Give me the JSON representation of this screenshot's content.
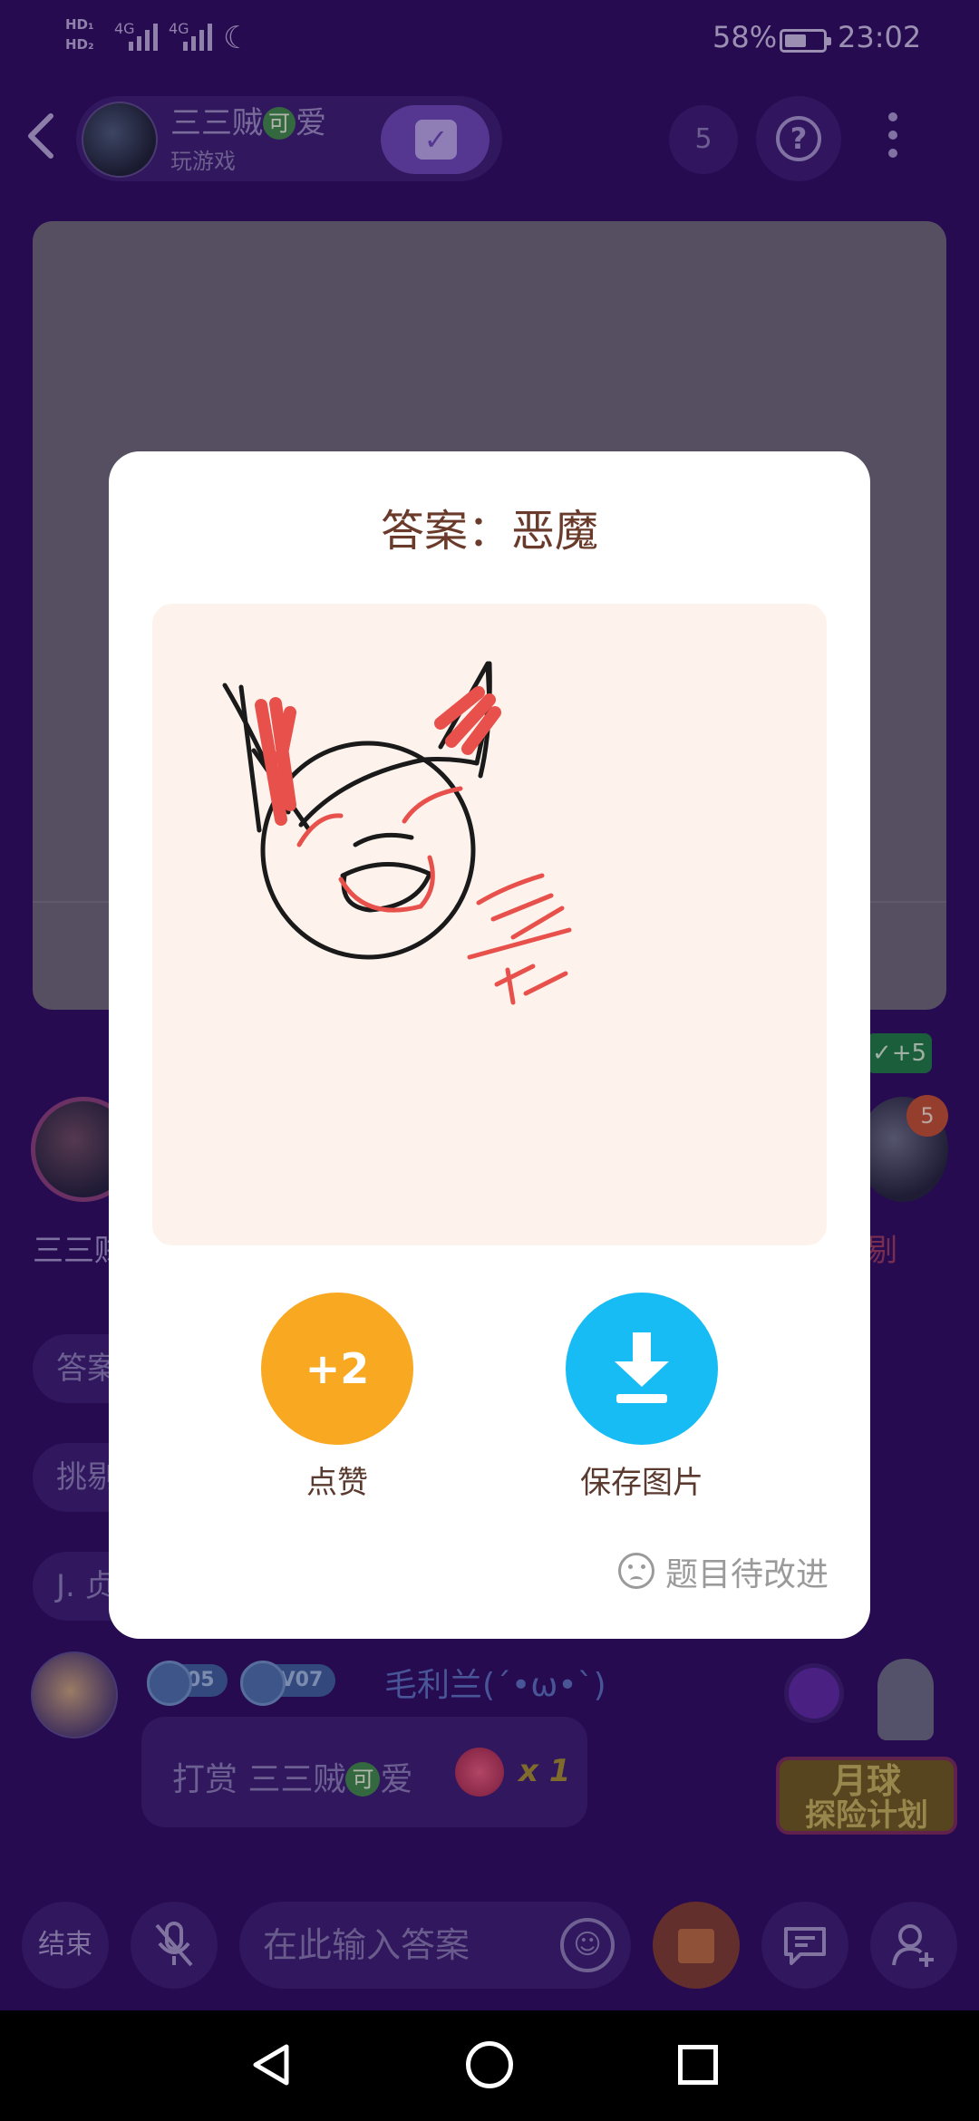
{
  "status_bar": {
    "hd1": "HD₁",
    "hd2": "HD₂",
    "net1": "4G",
    "net2": "4G",
    "battery": "58%",
    "battery_level": 0.58,
    "time": "23:02"
  },
  "header": {
    "host_name_prefix": "三三贼",
    "host_name_tag": "可",
    "host_name_suffix": "爱",
    "host_status": "玩游戏",
    "viewer_count": "5",
    "help": "?"
  },
  "players": {
    "left_name": "三三贼",
    "right_badge": "5",
    "right_plus": "✓+5",
    "right_name": "剔"
  },
  "chips": [
    "答案",
    "挑剔",
    "J. 贞"
  ],
  "chat": {
    "badge1": "05",
    "badge2": "V07",
    "username": "毛利兰(´•ω•`)",
    "text_prefix": "打赏 三三贼",
    "text_tag": "可",
    "text_suffix": "爱",
    "qty": "x 1"
  },
  "promo": {
    "line1": "月球",
    "line2": "探险计划"
  },
  "dialog": {
    "title": "答案：恶魔",
    "like_value": "+2",
    "like_label": "点赞",
    "save_label": "保存图片",
    "feedback": "题目待改进"
  },
  "bottom_bar": {
    "end_label": "结束",
    "input_placeholder": "在此输入答案"
  },
  "colors": {
    "background": "#2c0c5e",
    "like": "#f8a821",
    "save": "#18bcf4",
    "title": "#6a3a2b"
  }
}
